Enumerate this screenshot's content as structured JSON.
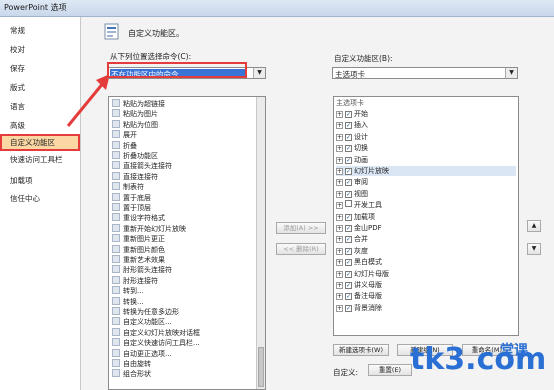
{
  "window": {
    "title": "PowerPoint 选项"
  },
  "nav": {
    "items": [
      {
        "label": "常规"
      },
      {
        "label": "校对"
      },
      {
        "label": "保存"
      },
      {
        "label": "版式"
      },
      {
        "label": "语言"
      },
      {
        "label": "高级"
      },
      {
        "label": "自定义功能区",
        "active": true
      },
      {
        "label": "快速访问工具栏"
      },
      {
        "label": "加载项"
      },
      {
        "label": "信任中心"
      }
    ]
  },
  "header": {
    "title": "自定义功能区。"
  },
  "left_panel": {
    "label": "从下列位置选择命令(C):",
    "combo_value": "不在功能区中的命令",
    "commands": [
      "粘贴为超链接",
      "粘贴为图片",
      "粘贴为位图",
      "展开",
      "折叠",
      "折叠功能区",
      "直接箭头连接符",
      "直接连接符",
      "制表符",
      "置于底层",
      "置于顶层",
      "重设字符格式",
      "重新开始幻灯片放映",
      "重新图片更正",
      "重新图片颜色",
      "重新艺术效果",
      "肘形箭头连接符",
      "肘形连接符",
      "转到...",
      "转换...",
      "转换为任意多边形",
      "自定义功能区...",
      "自定义幻灯片放映对话框",
      "自定义快速访问工具栏...",
      "自动更正选项...",
      "自由旋转",
      "组合形状"
    ]
  },
  "middle_buttons": {
    "add": "添加(A) >>",
    "remove": "<< 删除(R)"
  },
  "right_panel": {
    "label": "自定义功能区(B):",
    "combo_value": "主选项卡",
    "header": "主选项卡",
    "tabs": [
      {
        "label": "开始",
        "checked": true
      },
      {
        "label": "插入",
        "checked": true
      },
      {
        "label": "设计",
        "checked": true
      },
      {
        "label": "切换",
        "checked": true
      },
      {
        "label": "动画",
        "checked": true
      },
      {
        "label": "幻灯片放映",
        "checked": true,
        "selected": true
      },
      {
        "label": "审阅",
        "checked": true
      },
      {
        "label": "视图",
        "checked": true
      },
      {
        "label": "开发工具",
        "checked": false
      },
      {
        "label": "加载项",
        "checked": true
      },
      {
        "label": "金山PDF",
        "checked": true
      },
      {
        "label": "合并",
        "checked": true
      },
      {
        "label": "灰度",
        "checked": true
      },
      {
        "label": "黑白模式",
        "checked": true
      },
      {
        "label": "幻灯片母版",
        "checked": true
      },
      {
        "label": "讲义母版",
        "checked": true
      },
      {
        "label": "备注母版",
        "checked": true
      },
      {
        "label": "背景消除",
        "checked": true
      }
    ],
    "new_tab_btn": "新建选项卡(W)",
    "new_group_btn": "新建组(N)",
    "rename_btn": "重命名(M)...",
    "customize_label": "自定义:",
    "reset_btn": "重置(E)"
  },
  "watermark": {
    "brand": "tk3.com",
    "sub": "堂课"
  },
  "colors": {
    "accent_red": "#e43b3b",
    "selection_blue": "#3a73d6",
    "nav_active": "#fbd7a3",
    "watermark_blue": "#2a6fd4"
  }
}
